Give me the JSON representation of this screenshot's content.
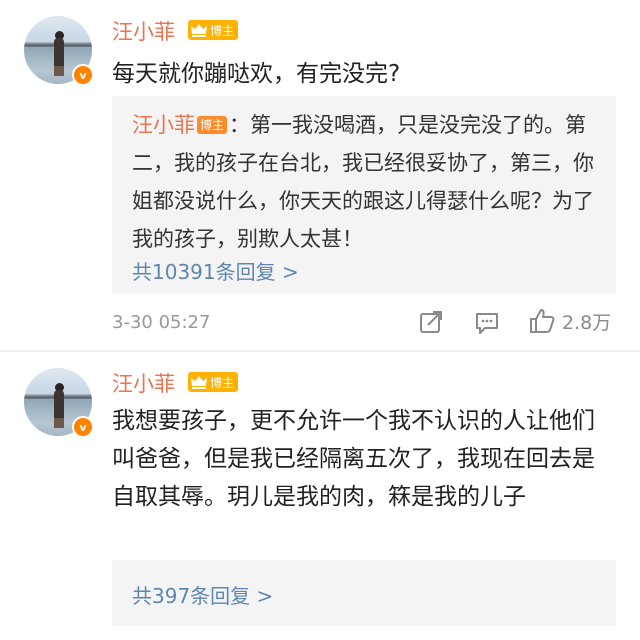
{
  "comments": [
    {
      "author": "汪小菲",
      "badge": "博主",
      "text": "每天就你蹦哒欢，有完没完?",
      "quote": {
        "author": "汪小菲",
        "badge": "博主",
        "text": "：第一我没喝酒，只是没完没了的。第二，我的孩子在台北，我已经很妥协了，第三，你姐都没说什么，你天天的跟这儿得瑟什么呢？为了我的孩子，别欺人太甚！"
      },
      "replies_label": "共10391条回复 >",
      "time": "3-30 05:27",
      "likes": "2.8万"
    },
    {
      "author": "汪小菲",
      "badge": "博主",
      "text": "我想要孩子，更不允许一个我不认识的人让他们叫爸爸，但是我已经隔离五次了，我现在回去是自取其辱。玥儿是我的肉，箖是我的儿子",
      "replies_label": "共397条回复 >"
    }
  ],
  "colors": {
    "name": "#eb7350",
    "link": "#5f86b0",
    "badge": "#ffb000",
    "verified": "#ff8200",
    "quote_bg": "#f4f4f4"
  },
  "icons": [
    "share-icon",
    "comment-icon",
    "like-icon",
    "verified-icon",
    "crown-icon"
  ]
}
